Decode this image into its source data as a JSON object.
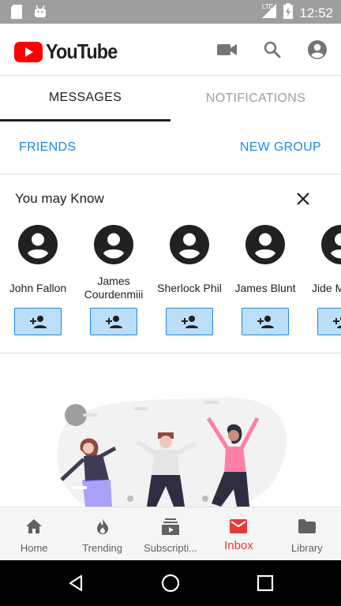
{
  "status_bar": {
    "time": "12:52",
    "network": "LTE",
    "icons": [
      "sd-card-icon",
      "android-icon",
      "signal-icon",
      "battery-icon"
    ]
  },
  "app_bar": {
    "logo_text": "YouTube",
    "icons": [
      "video-camera-icon",
      "search-icon",
      "account-icon"
    ]
  },
  "tabs": [
    {
      "label": "MESSAGES",
      "active": true
    },
    {
      "label": "NOTIFICATIONS",
      "active": false
    }
  ],
  "actions": {
    "friends": "FRIENDS",
    "new_group": "NEW GROUP"
  },
  "suggestions": {
    "title": "You may Know",
    "people": [
      {
        "name": "John Fallon"
      },
      {
        "name": "James Courdenmiii"
      },
      {
        "name": "Sherlock Phil"
      },
      {
        "name": "James Blunt"
      },
      {
        "name": "Jide M"
      }
    ]
  },
  "bottom_nav": [
    {
      "label": "Home",
      "icon": "home-icon",
      "active": false
    },
    {
      "label": "Trending",
      "icon": "flame-icon",
      "active": false
    },
    {
      "label": "Subscripti...",
      "icon": "subscriptions-icon",
      "active": false
    },
    {
      "label": "Inbox",
      "icon": "mail-icon",
      "active": true
    },
    {
      "label": "Library",
      "icon": "folder-icon",
      "active": false
    }
  ],
  "colors": {
    "brand_red": "#ff0000",
    "accent_blue": "#1e88e5",
    "add_button_bg": "#bbdefb",
    "active_nav": "#e53935"
  }
}
